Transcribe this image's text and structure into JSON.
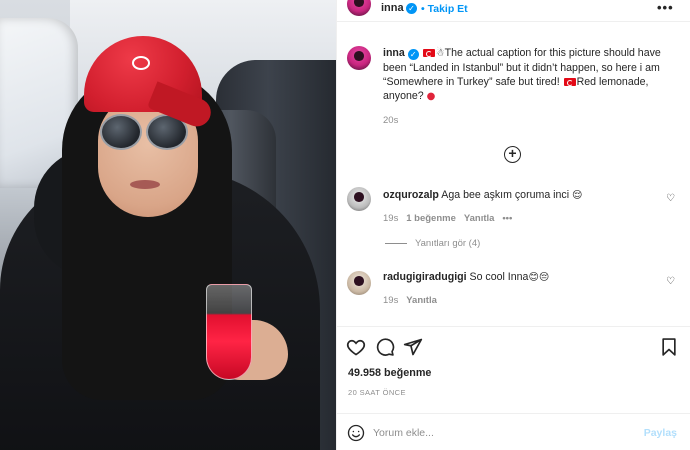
{
  "post": {
    "author": {
      "username": "inna",
      "verified_glyph": "✓",
      "follow_label": "Takip Et",
      "more_label": "•••"
    },
    "caption": {
      "username": "inna",
      "text_1": "The actual caption for this picture should have been “Landed in Istanbul” but it didn’t happen, so here i am “Somewhere in Turkey” safe but tired!",
      "text_2": "Red lemonade, anyone?",
      "time": "20s"
    },
    "comments": [
      {
        "username": "ozqurozalp",
        "text": "Aga bee aşkım çoruma inci",
        "emoji": "😌",
        "time": "19s",
        "likes": "1 beğenme",
        "reply_label": "Yanıtla",
        "more_label": "•••",
        "view_replies": "Yanıtları gör (4)"
      },
      {
        "username": "radugigiradugigi",
        "text": "So cool Inna",
        "emoji": "😊😔",
        "time": "19s",
        "reply_label": "Yanıtla"
      }
    ],
    "likes_count": "49.958 beğenme",
    "posted_ago": "20 SAAT ÖNCE",
    "comment_box": {
      "placeholder": "Yorum ekle...",
      "post_label": "Paylaş"
    },
    "icons": {
      "like": "heart-icon",
      "comment": "comment-bubble-icon",
      "share": "paper-plane-icon",
      "save": "bookmark-icon",
      "emoji": "smiley-icon",
      "add": "plus-circle-icon"
    },
    "colors": {
      "link_blue": "#0095f6",
      "muted": "#8e8e8e",
      "text": "#262626",
      "post_button_disabled": "#b2dffc"
    }
  }
}
